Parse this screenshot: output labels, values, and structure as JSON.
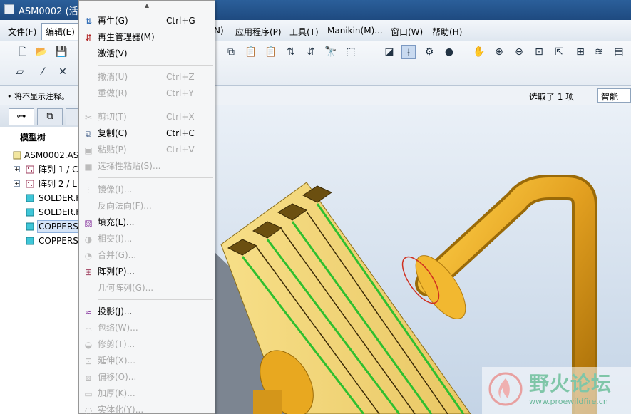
{
  "window": {
    "title": "ASM0002 (活动"
  },
  "menubar": {
    "items": [
      "文件(F)",
      "编辑(E)",
      "N)",
      "应用程序(P)",
      "工具(T)",
      "Manikin(M)...",
      "窗口(W)",
      "帮助(H)"
    ]
  },
  "status": {
    "message": "将不显示注释。",
    "selection": "选取了 1 项",
    "filter": "智能"
  },
  "model_tree": {
    "title": "模型树",
    "items": [
      "ASM0002.AS",
      "阵列 1 / C",
      "阵列 2 / L",
      "SOLDER.F",
      "SOLDER.F",
      "COPPERS",
      "COPPERS"
    ]
  },
  "edit_menu": {
    "items": [
      {
        "label": "再生(G)",
        "shortcut": "Ctrl+G"
      },
      {
        "label": "再生管理器(M)",
        "shortcut": ""
      },
      {
        "label": "激活(V)",
        "shortcut": ""
      },
      {
        "label": "撤消(U)",
        "shortcut": "Ctrl+Z"
      },
      {
        "label": "重做(R)",
        "shortcut": "Ctrl+Y"
      },
      {
        "label": "剪切(T)",
        "shortcut": "Ctrl+X"
      },
      {
        "label": "复制(C)",
        "shortcut": "Ctrl+C"
      },
      {
        "label": "粘贴(P)",
        "shortcut": "Ctrl+V"
      },
      {
        "label": "选择性粘贴(S)...",
        "shortcut": ""
      },
      {
        "label": "镜像(I)...",
        "shortcut": ""
      },
      {
        "label": "反向法向(F)...",
        "shortcut": ""
      },
      {
        "label": "填充(L)...",
        "shortcut": ""
      },
      {
        "label": "相交(I)...",
        "shortcut": ""
      },
      {
        "label": "合并(G)...",
        "shortcut": ""
      },
      {
        "label": "阵列(P)...",
        "shortcut": ""
      },
      {
        "label": "几何阵列(G)...",
        "shortcut": ""
      },
      {
        "label": "投影(J)...",
        "shortcut": ""
      },
      {
        "label": "包络(W)...",
        "shortcut": ""
      },
      {
        "label": "修剪(T)...",
        "shortcut": ""
      },
      {
        "label": "延伸(X)...",
        "shortcut": ""
      },
      {
        "label": "偏移(O)...",
        "shortcut": ""
      },
      {
        "label": "加厚(K)...",
        "shortcut": ""
      },
      {
        "label": "实体化(Y)...",
        "shortcut": ""
      }
    ]
  },
  "watermark": {
    "title": "野火论坛",
    "url": "www.proewildfire.cn"
  },
  "colors": {
    "accent": "#2b5f9a",
    "copper": "#e3a020",
    "heatsink": "#f0d070",
    "green_edge": "#2fbf2f"
  }
}
